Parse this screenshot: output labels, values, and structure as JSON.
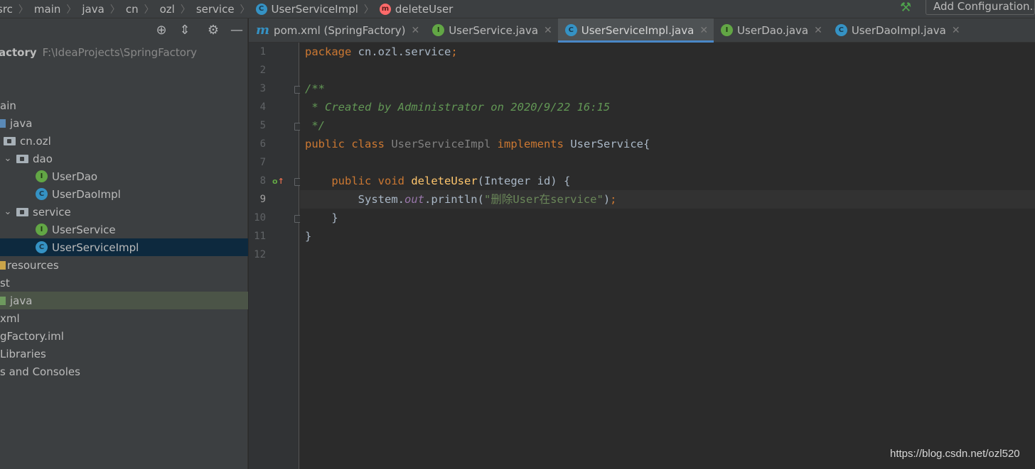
{
  "breadcrumb": {
    "items": [
      "src",
      "main",
      "java",
      "cn",
      "ozl",
      "service",
      "UserServiceImpl",
      "deleteUser"
    ]
  },
  "toolbar": {
    "add_config_label": "Add Configuration..."
  },
  "project": {
    "root_name": "actory",
    "root_path": "F:\\IdeaProjects\\SpringFactory",
    "rows": [
      {
        "label": "ain"
      },
      {
        "label": "java"
      },
      {
        "label": "cn.ozl"
      },
      {
        "label": "dao"
      },
      {
        "label": "UserDao",
        "icon": "I"
      },
      {
        "label": "UserDaoImpl",
        "icon": "C"
      },
      {
        "label": "service"
      },
      {
        "label": "UserService",
        "icon": "I"
      },
      {
        "label": "UserServiceImpl",
        "icon": "C"
      },
      {
        "label": "resources"
      },
      {
        "label": "st"
      },
      {
        "label": "java"
      },
      {
        "label": "xml"
      },
      {
        "label": "gFactory.iml"
      },
      {
        "label": "Libraries"
      },
      {
        "label": "s and Consoles"
      }
    ]
  },
  "tabs": [
    {
      "label": "pom.xml (SpringFactory)",
      "icon": "m"
    },
    {
      "label": "UserService.java",
      "icon": "I"
    },
    {
      "label": "UserServiceImpl.java",
      "icon": "C",
      "active": true
    },
    {
      "label": "UserDao.java",
      "icon": "I"
    },
    {
      "label": "UserDaoImpl.java",
      "icon": "C"
    }
  ],
  "gutter": {
    "line_numbers": [
      "1",
      "2",
      "3",
      "4",
      "5",
      "6",
      "7",
      "8",
      "9",
      "10",
      "11",
      "12"
    ],
    "current_line": "9"
  },
  "code": {
    "l1_kw": "package",
    "l1_rest": " cn.ozl.service",
    "l1_semi": ";",
    "l3": "/**",
    "l4": " * Created by Administrator on 2020/9/22 16:15",
    "l5": " */",
    "l6_kw": "public class",
    "l6_cls": "UserServiceImpl",
    "l6_impl": "implements",
    "l6_iface": "UserService{",
    "l8_kw": "public void",
    "l8_fn": "deleteUser",
    "l8_params": "(Integer id) {",
    "l9_obj": "System.",
    "l9_field": "out",
    "l9_call": ".println(",
    "l9_str": "\"删除User在service\"",
    "l9_end": ")",
    "l9_semi": ";",
    "l10": "}",
    "l11": "}"
  },
  "watermark": "https://blog.csdn.net/ozl520",
  "colors": {
    "keyword": "#cc7832",
    "comment": "#629755",
    "function": "#ffc66d",
    "string": "#6a8759",
    "accent": "#4a88c7"
  }
}
